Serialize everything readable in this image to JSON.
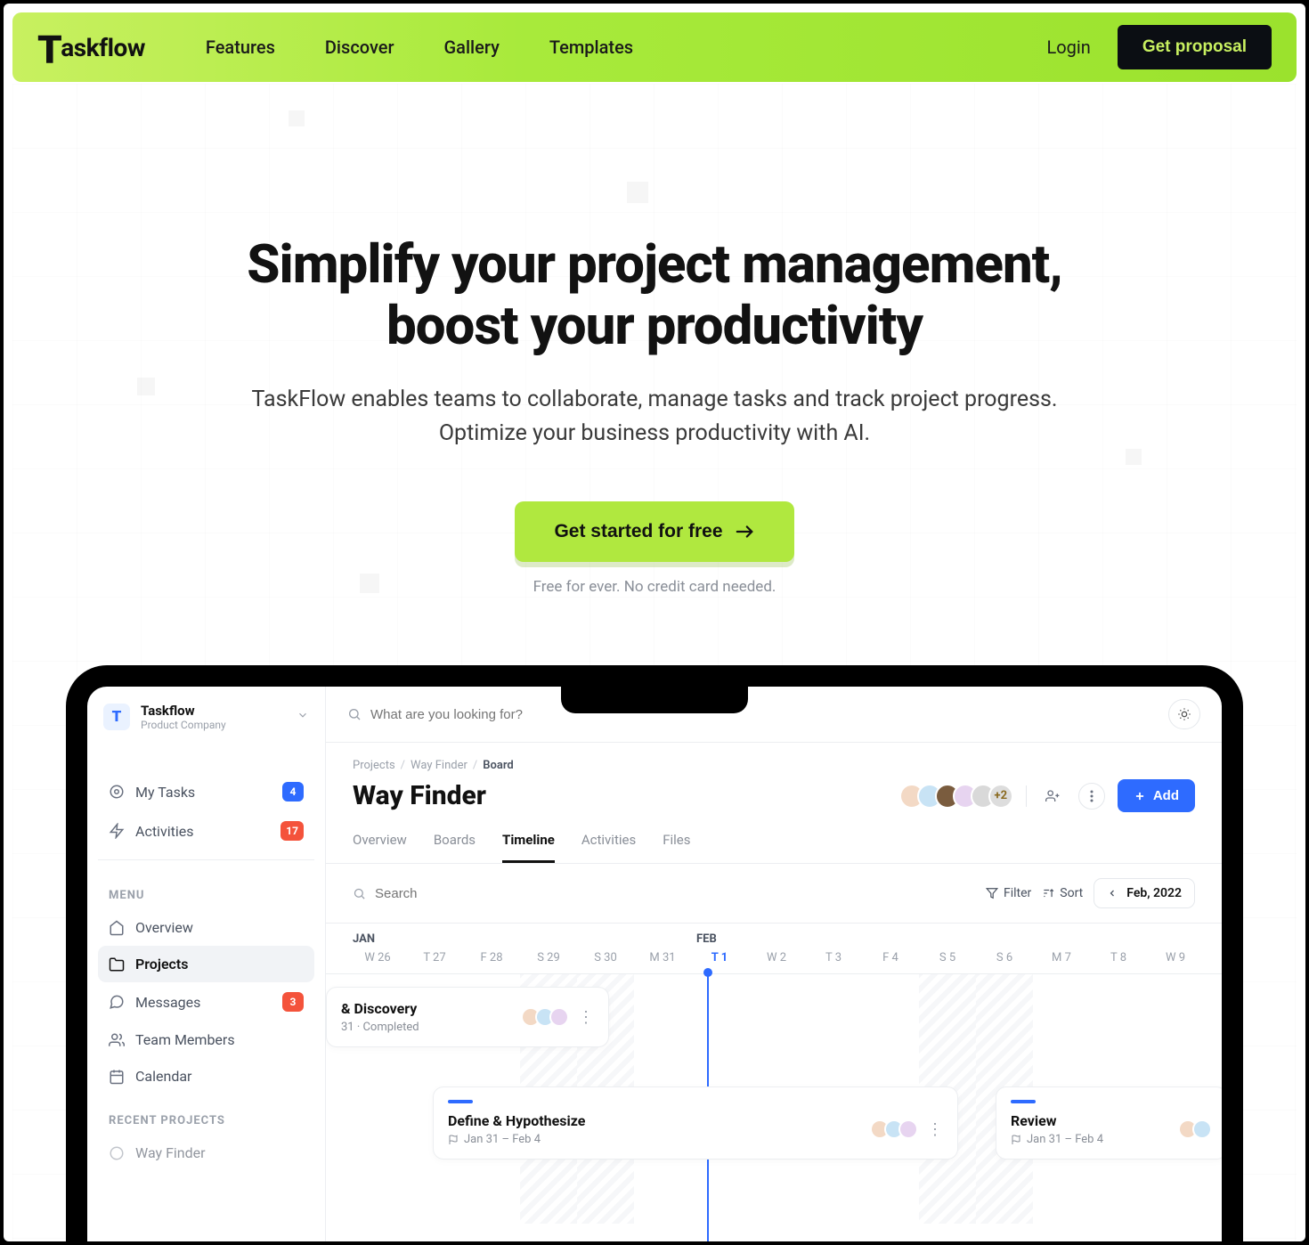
{
  "nav": {
    "brand": "askflow",
    "links": [
      "Features",
      "Discover",
      "Gallery",
      "Templates"
    ],
    "login": "Login",
    "cta": "Get proposal"
  },
  "hero": {
    "title_l1": "Simplify your project management,",
    "title_l2": "boost your productivity",
    "sub_l1": "TaskFlow enables teams to collaborate, manage tasks and track project progress.",
    "sub_l2": "Optimize your business productivity with AI.",
    "cta": "Get started for free",
    "note": "Free for ever. No credit card needed."
  },
  "app": {
    "workspace": {
      "name": "Taskflow",
      "company": "Product Company"
    },
    "search_placeholder": "What are you looking for?",
    "sidebar": {
      "my_tasks": {
        "label": "My Tasks",
        "badge": "4"
      },
      "activities": {
        "label": "Activities",
        "badge": "17"
      },
      "menu_heading": "MENU",
      "overview": "Overview",
      "projects": "Projects",
      "messages": {
        "label": "Messages",
        "badge": "3"
      },
      "team": "Team Members",
      "calendar": "Calendar",
      "recent_heading": "RECENT PROJECTS",
      "recent1": "Way Finder"
    },
    "crumbs": {
      "a": "Projects",
      "b": "Way Finder",
      "c": "Board"
    },
    "project_title": "Way Finder",
    "avatar_more": "+2",
    "add_button": "Add",
    "tabs": [
      "Overview",
      "Boards",
      "Timeline",
      "Activities",
      "Files"
    ],
    "active_tab": 2,
    "toolbar": {
      "search_placeholder": "Search",
      "filter": "Filter",
      "sort": "Sort",
      "date": "Feb, 2022"
    },
    "timeline": {
      "month1": "JAN",
      "month2": "FEB",
      "days": [
        "W 26",
        "T 27",
        "F 28",
        "S 29",
        "S 30",
        "M 31",
        "T 1",
        "W 2",
        "T 3",
        "F 4",
        "S 5",
        "S 6",
        "M 7",
        "T 8",
        "W 9"
      ],
      "today_index": 6,
      "cards": {
        "c1": {
          "title": "& Discovery",
          "meta": "31  ·  Completed"
        },
        "c2": {
          "title": "Define & Hypothesize",
          "meta": "Jan 31 – Feb 4"
        },
        "c3": {
          "title": "Review",
          "meta": "Jan 31 – Feb 4"
        }
      }
    }
  }
}
